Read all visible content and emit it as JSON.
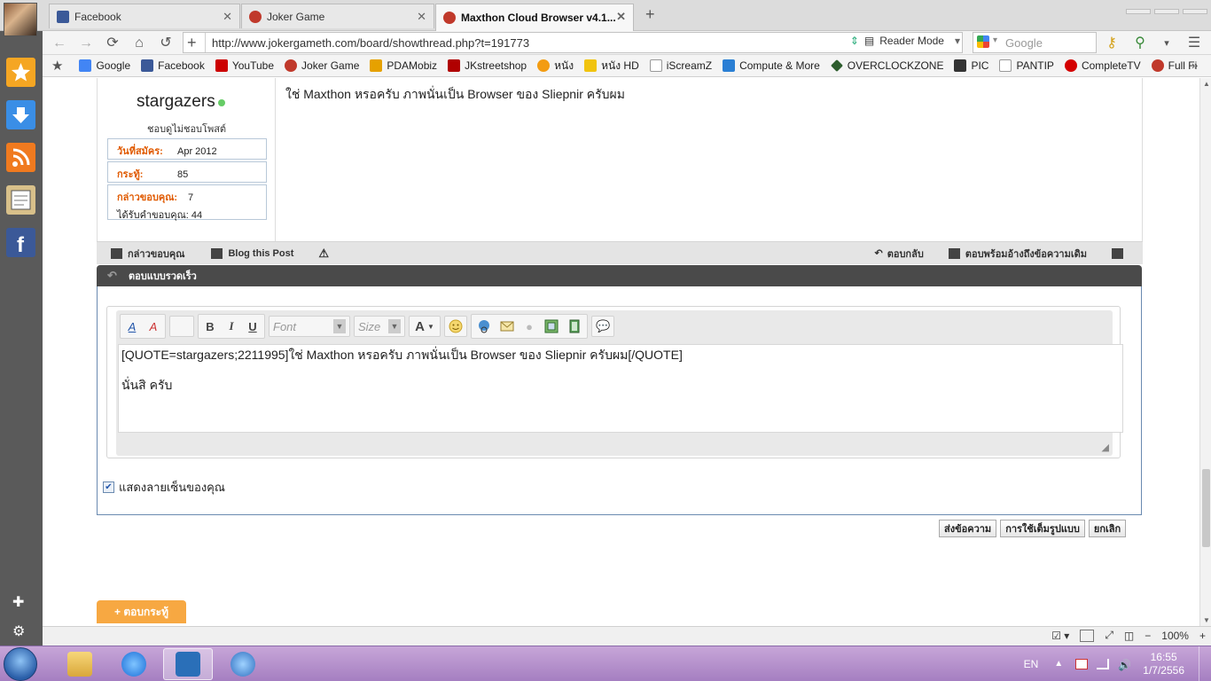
{
  "browser": {
    "tabs": [
      {
        "label": "Facebook",
        "icon_color": "#3b5998"
      },
      {
        "label": "Joker Game",
        "icon_color": "#c0392b"
      },
      {
        "label": "Maxthon Cloud Browser v4.1...",
        "icon_color": "#c0392b"
      }
    ],
    "new_tab_glyph": "+",
    "url": "http://www.jokergameth.com/board/showthread.php?t=191773",
    "reader_mode": "Reader Mode",
    "search_placeholder": "Google",
    "bookmarks": [
      {
        "label": "Google",
        "color": "#4285f4"
      },
      {
        "label": "Facebook",
        "color": "#3b5998"
      },
      {
        "label": "YouTube",
        "color": "#cc0000"
      },
      {
        "label": "Joker Game",
        "color": "#c0392b"
      },
      {
        "label": "PDAMobiz",
        "color": "#e6a100"
      },
      {
        "label": "JKstreetshop",
        "color": "#b00000"
      },
      {
        "label": "หนัง",
        "color": "#f39c12"
      },
      {
        "label": "หนัง HD",
        "color": "#f1c40f"
      },
      {
        "label": "iScreamZ",
        "color": "#ffffff"
      },
      {
        "label": "Compute & More",
        "color": "#2a7fd4"
      },
      {
        "label": "OVERCLOCKZONE",
        "color": "#2e5d2e"
      },
      {
        "label": "PIC",
        "color": "#333333"
      },
      {
        "label": "PANTIP",
        "color": "#ffffff"
      },
      {
        "label": "CompleteTV",
        "color": "#d40000"
      },
      {
        "label": "Full Fi",
        "color": "#c0392b"
      }
    ]
  },
  "sidebar_icons": [
    {
      "name": "favorites-icon",
      "color": "#f5a623"
    },
    {
      "name": "download-icon",
      "color": "#3a8ee6"
    },
    {
      "name": "rss-icon",
      "color": "#f07a1f"
    },
    {
      "name": "notepad-icon",
      "color": "#d8c08a"
    },
    {
      "name": "facebook-icon",
      "color": "#3b5998"
    }
  ],
  "post": {
    "username": "stargazers",
    "usertitle": "ชอบดูไม่ชอบโพสต์",
    "join_label": "วันที่สมัคร:",
    "join_value": "Apr 2012",
    "threads_label": "กระทู้:",
    "threads_value": "85",
    "thanks_label": "กล่าวขอบคุณ:",
    "thanks_value": "7",
    "thanked_label": "ได้รับคำขอบคุณ: 44",
    "text": "ใช่ Maxthon หรอครับ ภาพนั่นเป็น Browser ของ Sliepnir ครับผม"
  },
  "post_footer": {
    "thank": "กล่าวขอบคุณ",
    "blog": "Blog this Post",
    "reply": "ตอบกลับ",
    "reply_quote": "ตอบพร้อมอ้างถึงข้อความเดิม"
  },
  "quick_reply": {
    "header": "ตอบแบบรวดเร็ว",
    "font_placeholder": "Font",
    "size_placeholder": "Size",
    "line1": "[QUOTE=stargazers;2211995]ใช่ Maxthon หรอครับ ภาพนั่นเป็น Browser ของ Sliepnir ครับผม[/QUOTE]",
    "line2": "นั่นสิ ครับ",
    "signature_label": "แสดงลายเซ็นของคุณ",
    "submit": "ส่งข้อความ",
    "advanced": "การใช้เต็มรูปแบบ",
    "cancel": "ยกเลิก"
  },
  "reply_thread_button": "+ ตอบกระทู้",
  "statusbar": {
    "zoom": "100%"
  },
  "taskbar": {
    "lang": "EN",
    "time": "16:55",
    "date": "1/7/2556"
  }
}
